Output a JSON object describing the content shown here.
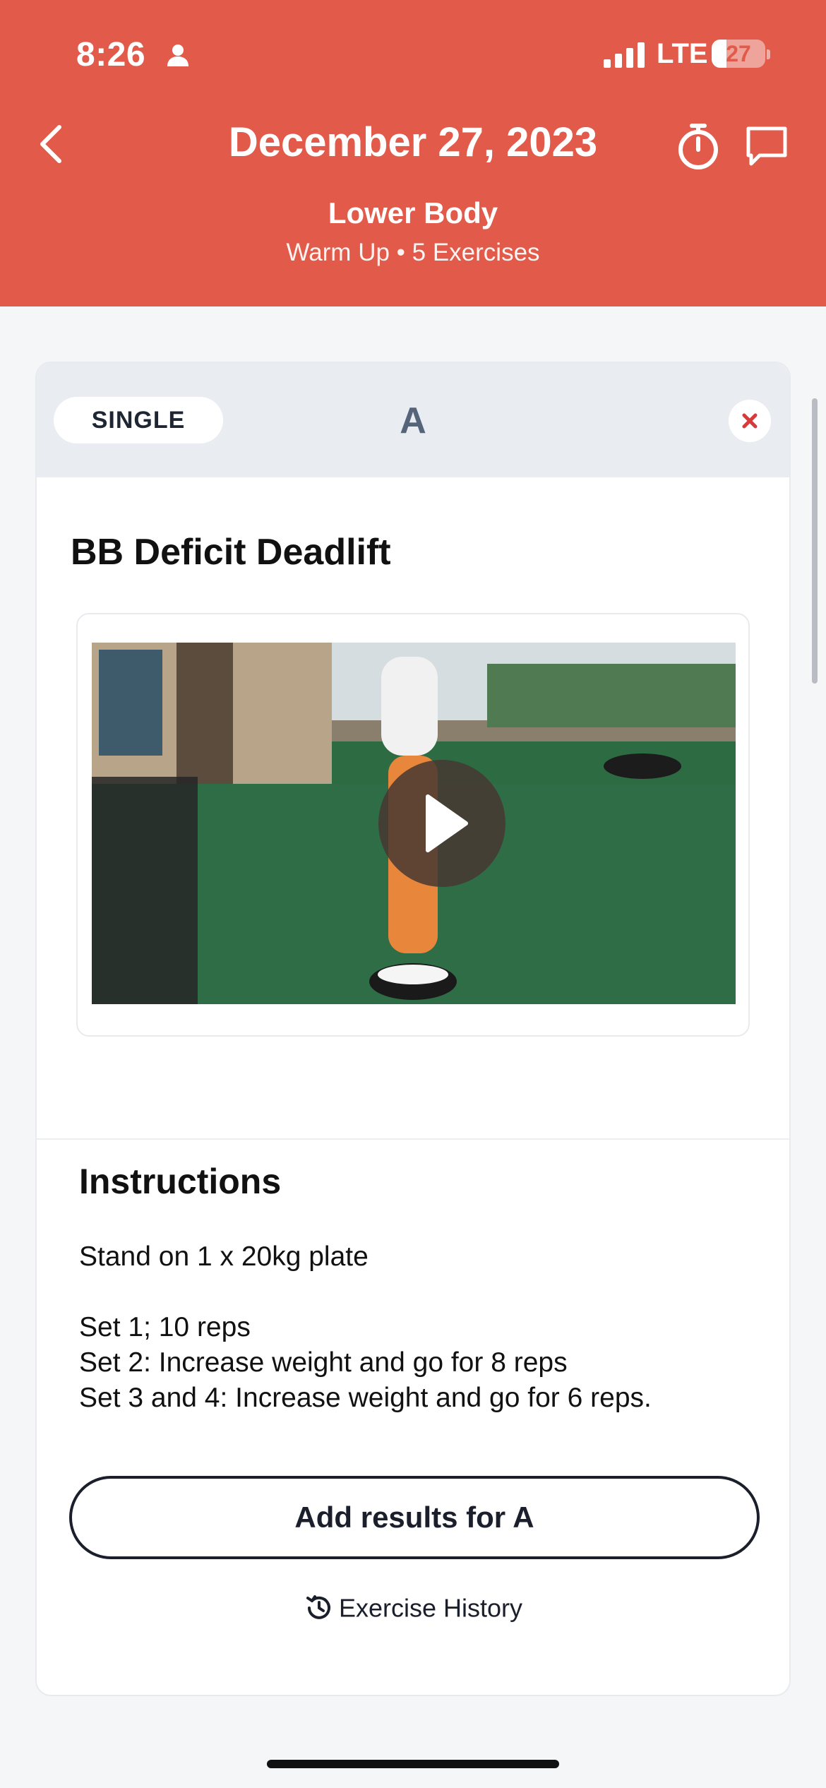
{
  "status_bar": {
    "time": "8:26",
    "network": "LTE",
    "battery": "27",
    "battery_level": 0.27
  },
  "header": {
    "title": "December 27, 2023",
    "subtitle": "Lower Body",
    "meta": "Warm Up • 5 Exercises",
    "background_color": "#e15a4a"
  },
  "card": {
    "type_label": "SINGLE",
    "letter": "A",
    "exercise_name": "BB Deficit Deadlift",
    "instructions_title": "Instructions",
    "instructions": [
      "Stand on 1 x 20kg plate",
      "Set 1; 10 reps",
      "Set 2: Increase weight and go for 8 reps",
      "Set 3 and 4: Increase weight and go for 6 reps."
    ],
    "results_button": "Add results for A",
    "history_link": "Exercise History"
  },
  "icons": {
    "back": "chevron-left-icon",
    "timer": "stopwatch-icon",
    "chat": "chat-bubble-icon",
    "close": "close-icon",
    "play": "play-icon",
    "history": "history-icon"
  }
}
